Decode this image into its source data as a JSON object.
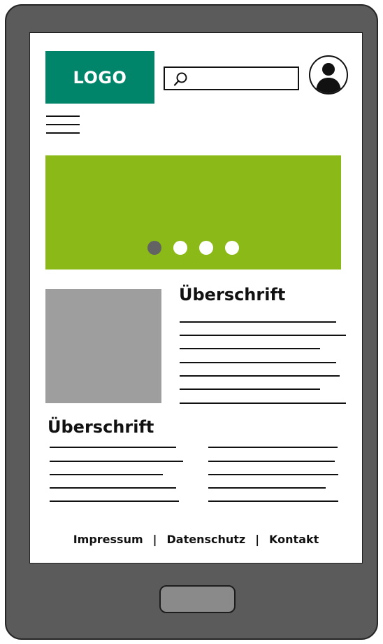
{
  "header": {
    "logo_label": "LOGO"
  },
  "carousel": {
    "slide_count": 4,
    "active_index": 0
  },
  "section1": {
    "heading": "Überschrift"
  },
  "section2": {
    "heading": "Überschrift"
  },
  "footer": {
    "links": [
      "Impressum",
      "Datenschutz",
      "Kontakt"
    ],
    "separator": "|"
  },
  "colors": {
    "device": "#5b5b5b",
    "logo_bg": "#00856b",
    "hero_bg": "#8bba18",
    "image_placeholder": "#9e9e9e",
    "dot_active": "#636363",
    "dot_inactive": "#ffffff"
  },
  "icons": {
    "search": "search-icon",
    "user": "user-icon",
    "menu": "hamburger-menu-icon"
  }
}
